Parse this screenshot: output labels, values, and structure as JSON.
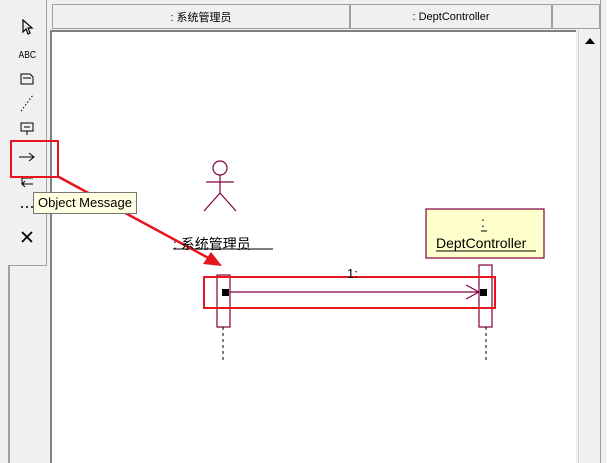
{
  "header": {
    "lifeline1_title": ": 系统管理员",
    "lifeline2_title": ": DeptController"
  },
  "toolbar": {
    "items": [
      {
        "icon": "selector-arrow-icon"
      },
      {
        "label": "ABC",
        "icon": "text-icon"
      },
      {
        "icon": "note-icon"
      },
      {
        "icon": "anchor-note-icon"
      },
      {
        "icon": "object-icon"
      },
      {
        "icon": "object-message-icon"
      },
      {
        "icon": "message-to-self-icon"
      },
      {
        "icon": "return-message-icon"
      },
      {
        "icon": "destruction-marker-icon"
      }
    ]
  },
  "tooltip": {
    "text": "Object Message"
  },
  "diagram": {
    "actor_label": ": 系统管理员",
    "object_colon": ":",
    "object_name": "DeptController",
    "message_label": "1:"
  },
  "colors": {
    "highlight_red": "#e8141e",
    "uml_maroon": "#800040",
    "object_fill": "#ffffcc"
  }
}
